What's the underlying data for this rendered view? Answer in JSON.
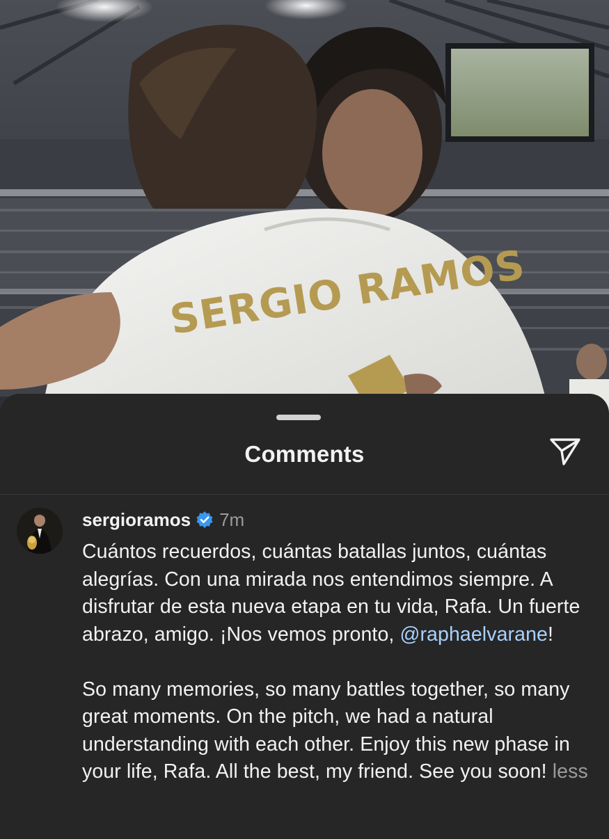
{
  "photo": {
    "jersey_name": "SERGIO RAMOS",
    "jersey_lettering_color": "#b59a52"
  },
  "sheet": {
    "title": "Comments",
    "share_icon": "paper-plane-icon"
  },
  "comment": {
    "username": "sergioramos",
    "verified": true,
    "verified_badge_color": "#3897f0",
    "time_ago": "7m",
    "spanish_text": "Cuántos recuerdos, cuántas batallas juntos, cuántas alegrías. Con una mirada nos entendimos siempre. A disfrutar de esta nueva etapa en tu vida, Rafa. Un fuerte abrazo, amigo. ¡Nos vemos pronto, ",
    "mention": "@raphaelvarane",
    "spanish_suffix": "!",
    "english_text": "So many memories, so many battles together, so many great moments. On the pitch, we had a natural understanding with each other. Enjoy this new phase in your life, Rafa. All the best, my friend. See you soon!",
    "less_label": "less"
  },
  "colors": {
    "sheet_background": "#262626",
    "primary_text": "#f2f2f2",
    "secondary_text": "#9b9b9b",
    "link": "#a8d1ff"
  }
}
